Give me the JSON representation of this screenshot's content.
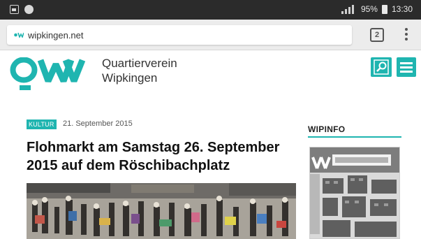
{
  "status_bar": {
    "battery_percent": "95%",
    "time": "13:30"
  },
  "browser": {
    "url": "wipkingen.net",
    "tab_count": "2"
  },
  "site": {
    "org_line1": "Quartierverein",
    "org_line2": "Wipkingen",
    "accent_color": "#1fb5b0"
  },
  "article": {
    "category": "KULTUR",
    "date": "21. September 2015",
    "title_line1": "Flohmarkt am Samstag 26. September",
    "title_line2": "2015 auf dem Röschibachplatz"
  },
  "sidebar": {
    "title": "WIPINFO"
  }
}
